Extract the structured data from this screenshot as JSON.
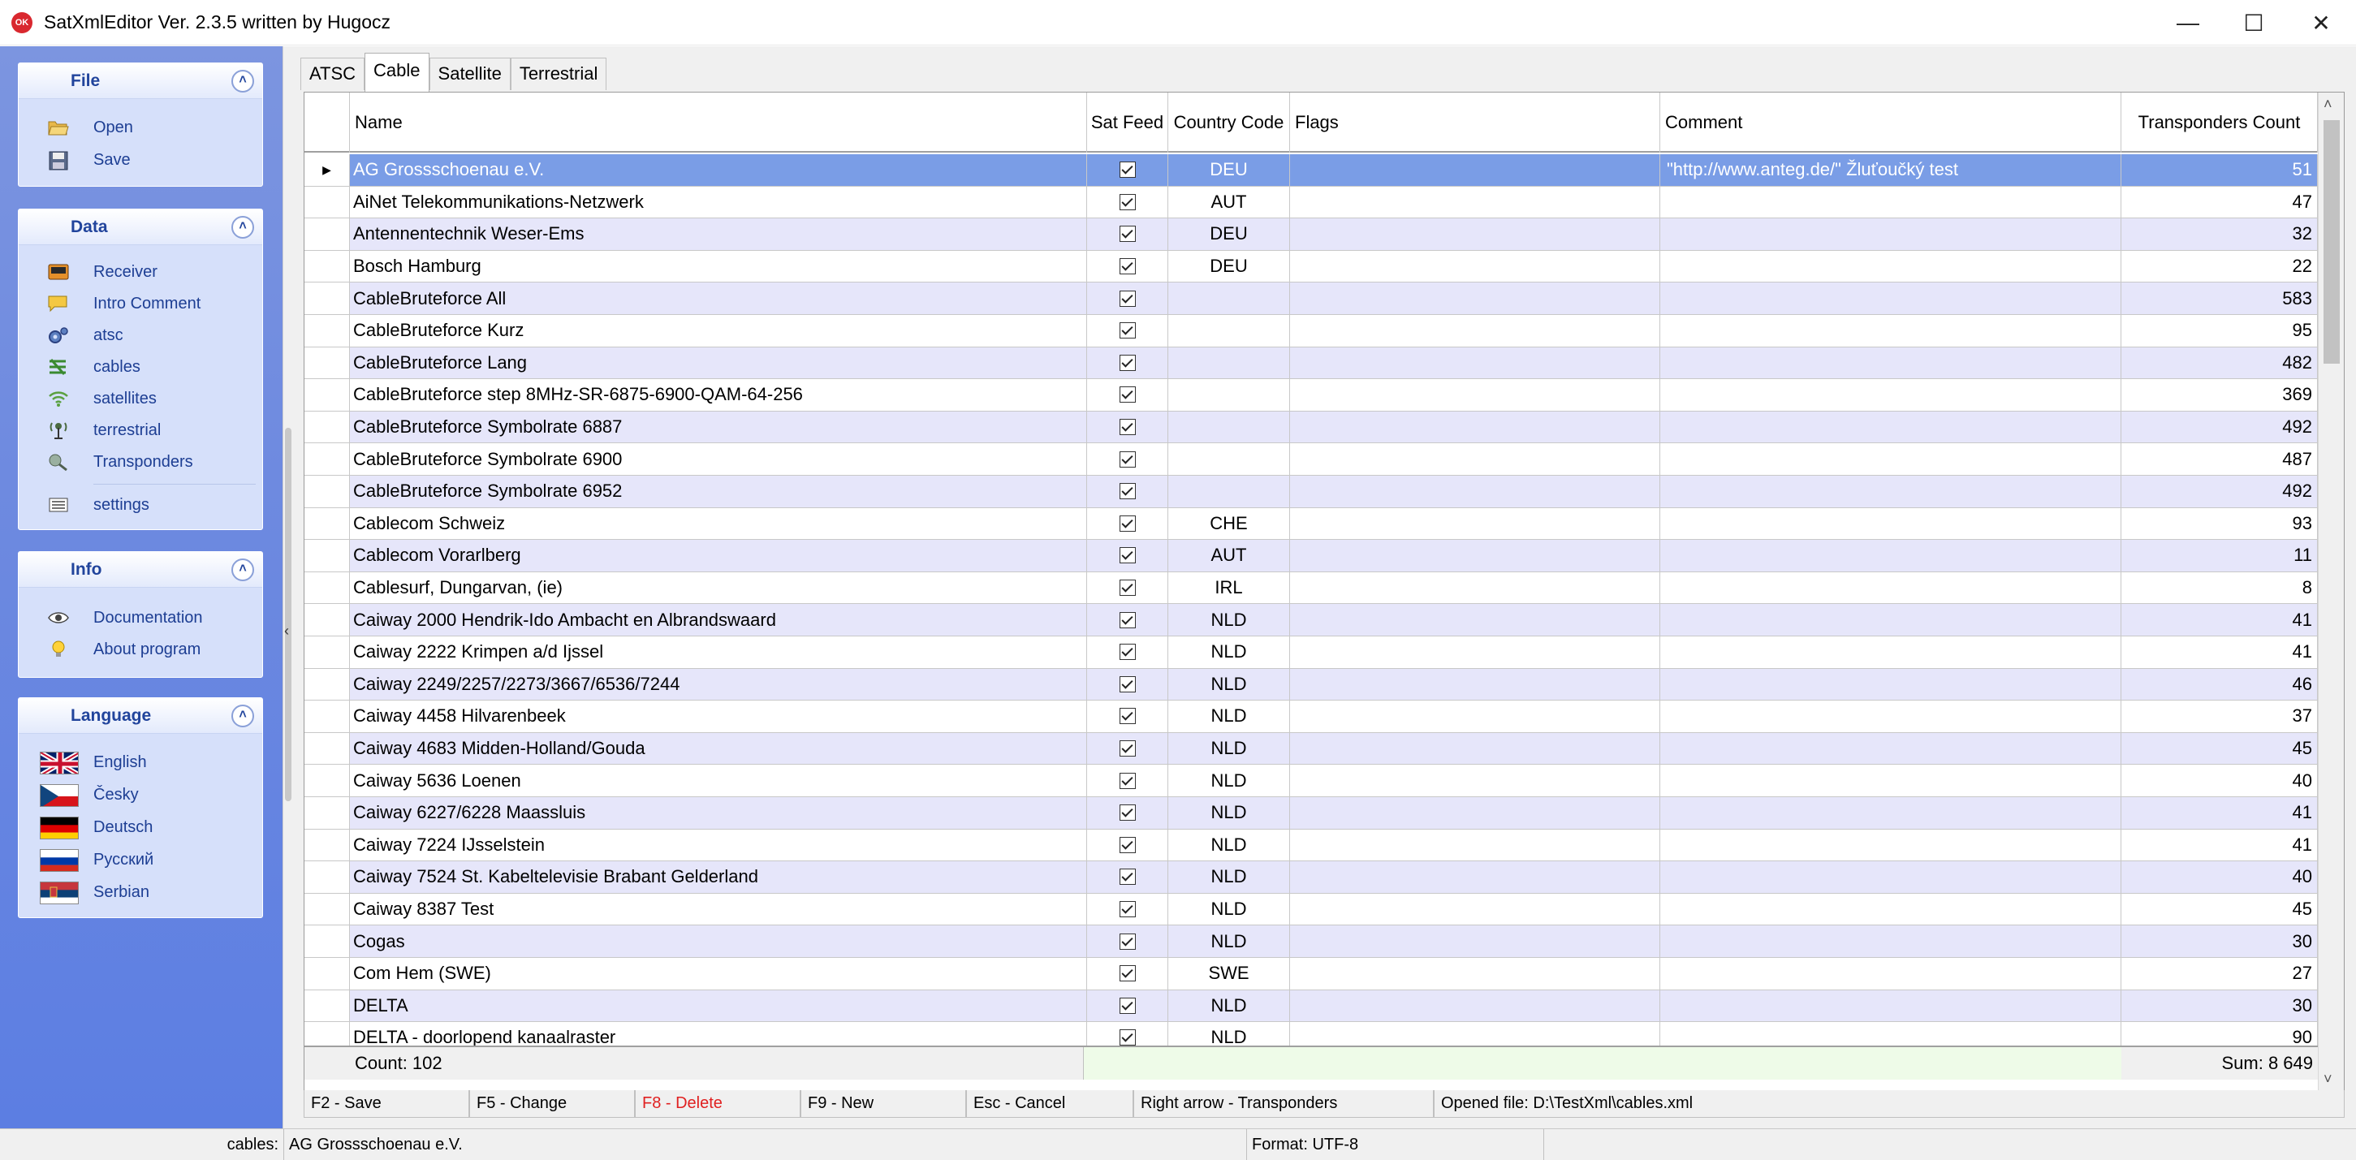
{
  "window": {
    "title": "SatXmlEditor Ver. 2.3.5 written by Hugocz",
    "icon_text": "OK",
    "buttons": [
      "minimize",
      "maximize",
      "close"
    ]
  },
  "sidebar": {
    "file": {
      "title": "File",
      "items": [
        {
          "label": "Open",
          "icon": "folder-open-icon"
        },
        {
          "label": "Save",
          "icon": "save-icon"
        }
      ]
    },
    "data": {
      "title": "Data",
      "items": [
        {
          "label": "Receiver",
          "icon": "receiver-icon"
        },
        {
          "label": "Intro Comment",
          "icon": "comment-icon"
        },
        {
          "label": "atsc",
          "icon": "gears-icon"
        },
        {
          "label": "cables",
          "icon": "cables-icon"
        },
        {
          "label": "satellites",
          "icon": "wifi-icon"
        },
        {
          "label": "terrestrial",
          "icon": "antenna-icon"
        },
        {
          "label": "Transponders",
          "icon": "transponders-icon"
        },
        {
          "label": "settings",
          "icon": "settings-icon"
        }
      ]
    },
    "info": {
      "title": "Info",
      "items": [
        {
          "label": "Documentation",
          "icon": "eye-icon"
        },
        {
          "label": "About program",
          "icon": "lightbulb-icon"
        }
      ]
    },
    "language": {
      "title": "Language",
      "items": [
        {
          "label": "English",
          "flag": "uk"
        },
        {
          "label": "Česky",
          "flag": "cz"
        },
        {
          "label": "Deutsch",
          "flag": "de"
        },
        {
          "label": "Русский",
          "flag": "ru"
        },
        {
          "label": "Serbian",
          "flag": "rs"
        }
      ]
    }
  },
  "tabs": [
    "ATSC",
    "Cable",
    "Satellite",
    "Terrestrial"
  ],
  "active_tab": "Cable",
  "grid": {
    "headers": {
      "name": "Name",
      "sat_feed": "Sat Feed",
      "country_code": "Country Code",
      "flags": "Flags",
      "comment": "Comment",
      "transponders_count": "Transponders Count"
    },
    "rows": [
      {
        "name": "AG Grossschoenau e.V.",
        "country": "DEU",
        "flags": "",
        "comment": "\"http://www.anteg.de/\" Žluťoučký test",
        "count": "51",
        "selected": true
      },
      {
        "name": "AiNet Telekommunikations-Netzwerk",
        "country": "AUT",
        "flags": "",
        "comment": "",
        "count": "47"
      },
      {
        "name": "Antennentechnik Weser-Ems",
        "country": "DEU",
        "flags": "",
        "comment": "",
        "count": "32"
      },
      {
        "name": "Bosch Hamburg",
        "country": "DEU",
        "flags": "",
        "comment": "",
        "count": "22"
      },
      {
        "name": "CableBruteforce All",
        "country": "",
        "flags": "",
        "comment": "",
        "count": "583"
      },
      {
        "name": "CableBruteforce Kurz",
        "country": "",
        "flags": "",
        "comment": "",
        "count": "95"
      },
      {
        "name": "CableBruteforce Lang",
        "country": "",
        "flags": "",
        "comment": "",
        "count": "482"
      },
      {
        "name": "CableBruteforce step 8MHz-SR-6875-6900-QAM-64-256",
        "country": "",
        "flags": "",
        "comment": "",
        "count": "369"
      },
      {
        "name": "CableBruteforce Symbolrate 6887",
        "country": "",
        "flags": "",
        "comment": "",
        "count": "492"
      },
      {
        "name": "CableBruteforce Symbolrate 6900",
        "country": "",
        "flags": "",
        "comment": "",
        "count": "487"
      },
      {
        "name": "CableBruteforce Symbolrate 6952",
        "country": "",
        "flags": "",
        "comment": "",
        "count": "492"
      },
      {
        "name": "Cablecom Schweiz",
        "country": "CHE",
        "flags": "",
        "comment": "",
        "count": "93"
      },
      {
        "name": "Cablecom Vorarlberg",
        "country": "AUT",
        "flags": "",
        "comment": "",
        "count": "11"
      },
      {
        "name": "Cablesurf, Dungarvan, (ie)",
        "country": "IRL",
        "flags": "",
        "comment": "",
        "count": "8"
      },
      {
        "name": "Caiway 2000 Hendrik-Ido Ambacht en Albrandswaard",
        "country": "NLD",
        "flags": "",
        "comment": "",
        "count": "41"
      },
      {
        "name": "Caiway 2222 Krimpen a/d Ijssel",
        "country": "NLD",
        "flags": "",
        "comment": "",
        "count": "41"
      },
      {
        "name": "Caiway 2249/2257/2273/3667/6536/7244",
        "country": "NLD",
        "flags": "",
        "comment": "",
        "count": "46"
      },
      {
        "name": "Caiway 4458 Hilvarenbeek",
        "country": "NLD",
        "flags": "",
        "comment": "",
        "count": "37"
      },
      {
        "name": "Caiway 4683 Midden-Holland/Gouda",
        "country": "NLD",
        "flags": "",
        "comment": "",
        "count": "45"
      },
      {
        "name": "Caiway 5636 Loenen",
        "country": "NLD",
        "flags": "",
        "comment": "",
        "count": "40"
      },
      {
        "name": "Caiway 6227/6228 Maassluis",
        "country": "NLD",
        "flags": "",
        "comment": "",
        "count": "41"
      },
      {
        "name": "Caiway 7224 IJsselstein",
        "country": "NLD",
        "flags": "",
        "comment": "",
        "count": "41"
      },
      {
        "name": "Caiway 7524 St. Kabeltelevisie Brabant Gelderland",
        "country": "NLD",
        "flags": "",
        "comment": "",
        "count": "40"
      },
      {
        "name": "Caiway 8387 Test",
        "country": "NLD",
        "flags": "",
        "comment": "",
        "count": "45"
      },
      {
        "name": "Cogas",
        "country": "NLD",
        "flags": "",
        "comment": "",
        "count": "30"
      },
      {
        "name": "Com Hem (SWE)",
        "country": "SWE",
        "flags": "",
        "comment": "",
        "count": "27"
      },
      {
        "name": "DELTA",
        "country": "NLD",
        "flags": "",
        "comment": "",
        "count": "30"
      },
      {
        "name": "DELTA - doorlopend kanaalraster",
        "country": "NLD",
        "flags": "",
        "comment": "",
        "count": "90"
      }
    ],
    "footer": {
      "count_label": "Count:   102",
      "sum_label": "Sum:  8 649"
    }
  },
  "hotkeys": [
    {
      "label": "F2 - Save",
      "red": false
    },
    {
      "label": "F5 - Change",
      "red": false
    },
    {
      "label": "F8 - Delete",
      "red": true
    },
    {
      "label": "F9 - New",
      "red": false
    },
    {
      "label": "Esc - Cancel",
      "red": false
    },
    {
      "label": "Right arrow - Transponders",
      "red": false
    },
    {
      "label": "Opened file: D:\\TestXml\\cables.xml",
      "red": false
    }
  ],
  "statusbar": {
    "section": "cables:",
    "current": "AG Grossschoenau e.V.",
    "format": "Format: UTF-8"
  },
  "colors": {
    "sidebar_gradient_top": "#7c95e0",
    "sidebar_gradient_bottom": "#5c7ee2",
    "selected_row": "#7a9de6",
    "alt_row": "#e6e6fa",
    "delete_hotkey": "#e02020",
    "sidebar_link": "#1d3e93"
  }
}
